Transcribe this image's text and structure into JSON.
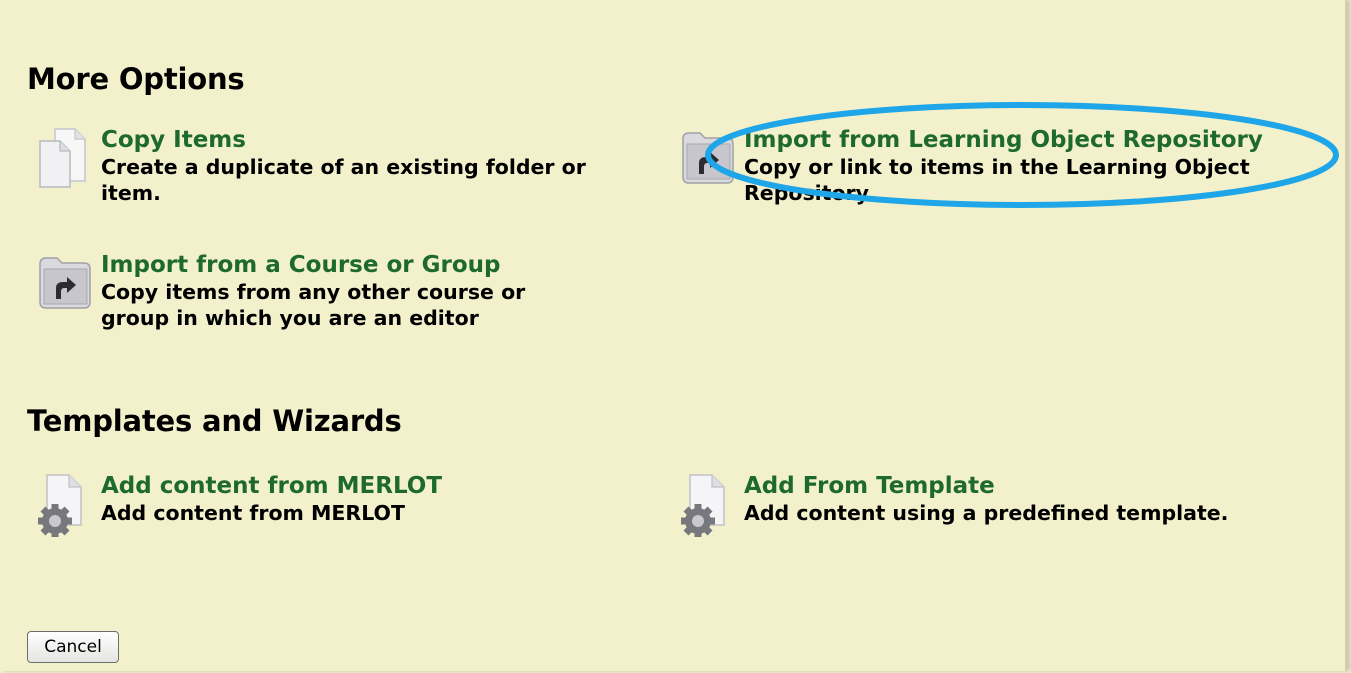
{
  "sections": {
    "more_options": {
      "heading": "More Options",
      "items": [
        {
          "title": "Copy Items",
          "desc": "Create a duplicate of an existing folder or item."
        },
        {
          "title": "Import from Learning Object Repository",
          "desc": "Copy or link to items in the Learning Object Repository"
        },
        {
          "title": "Import from a Course or Group",
          "desc": "Copy items from any other course or group in which you are an editor"
        }
      ]
    },
    "templates": {
      "heading": "Templates and Wizards",
      "items": [
        {
          "title": "Add content from MERLOT",
          "desc": "Add content from MERLOT"
        },
        {
          "title": "Add From Template",
          "desc": "Add content using a predefined template."
        }
      ]
    }
  },
  "cancel_label": "Cancel",
  "icons": {
    "copy": "copy-documents-icon",
    "import": "import-folder-icon",
    "wizard": "gear-document-icon"
  },
  "colors": {
    "background": "#f2f1cc",
    "link": "#1e6a2e",
    "highlight": "#1ea6e8"
  }
}
